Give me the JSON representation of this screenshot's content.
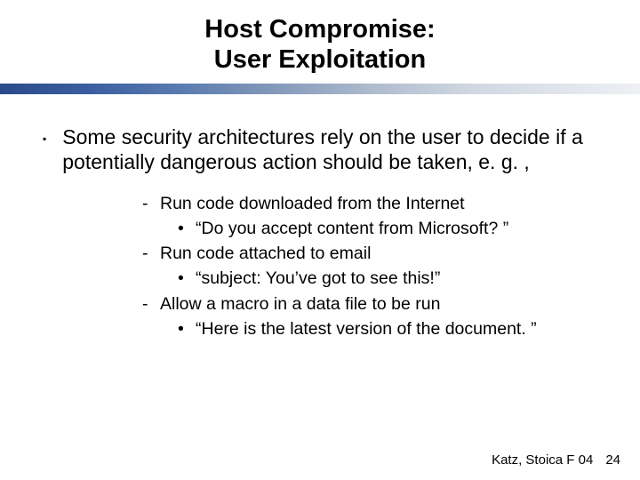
{
  "title_line1": "Host Compromise:",
  "title_line2": "User Exploitation",
  "main_bullet": "Some security architectures rely on the user to decide if a potentially dangerous action should be taken, e. g. ,",
  "items": [
    {
      "text": "Run code downloaded from the Internet",
      "example": "“Do you accept content from Microsoft? ”"
    },
    {
      "text": "Run code attached to email",
      "example": "“subject: You’ve got to see this!”"
    },
    {
      "text": "Allow a macro in a data file to be run",
      "example": "“Here is the latest version of the document. ”"
    }
  ],
  "footer_text": "Katz, Stoica F 04",
  "page_number": "24"
}
